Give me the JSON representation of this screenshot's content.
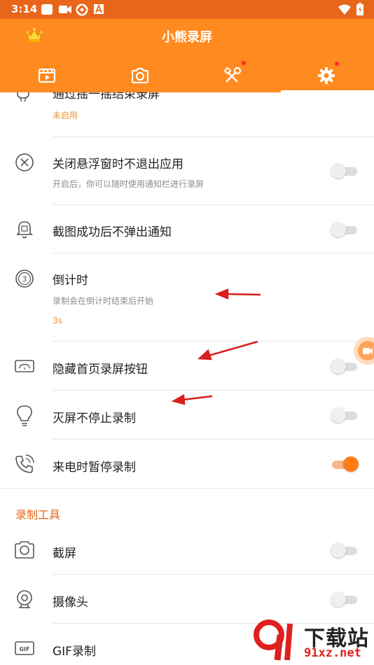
{
  "status_bar": {
    "time": "3:14"
  },
  "app": {
    "title": "小熊录屏"
  },
  "tabs": [
    {
      "name": "videos",
      "icon": "video-list-icon"
    },
    {
      "name": "screenshots",
      "icon": "camera-icon"
    },
    {
      "name": "tools",
      "icon": "tools-icon",
      "badge": true
    },
    {
      "name": "settings",
      "icon": "gear-icon",
      "badge": true,
      "active": true
    }
  ],
  "settings": {
    "shake_stop": {
      "label": "通过摇一摇结束录屏",
      "value": "未启用"
    },
    "keep_app": {
      "label": "关闭悬浮窗时不退出应用",
      "desc": "开启后，你可以随时使用通知栏进行录屏",
      "on": false
    },
    "no_notify": {
      "label": "截图成功后不弹出通知",
      "on": false
    },
    "countdown": {
      "label": "倒计时",
      "desc": "录制会在倒计时结束后开始",
      "value": "3s"
    },
    "hide_button": {
      "label": "隐藏首页录屏按钮",
      "on": false
    },
    "screen_off": {
      "label": "灭屏不停止录制",
      "on": false
    },
    "call_pause": {
      "label": "来电时暂停录制",
      "on": true
    }
  },
  "tools_section": {
    "title": "录制工具",
    "items": [
      {
        "label": "截屏",
        "icon": "camera-icon",
        "on": false
      },
      {
        "label": "摄像头",
        "icon": "webcam-icon",
        "on": false
      },
      {
        "label": "GIF录制",
        "icon": "gif-icon",
        "on": false
      }
    ]
  },
  "watermark": {
    "brand": "下载站",
    "url": "91xz.net"
  },
  "colors": {
    "accent": "#ff8a1f",
    "status_bar": "#e8661a",
    "toggle_on": "#ff7b14",
    "value_text": "#f0923a"
  }
}
